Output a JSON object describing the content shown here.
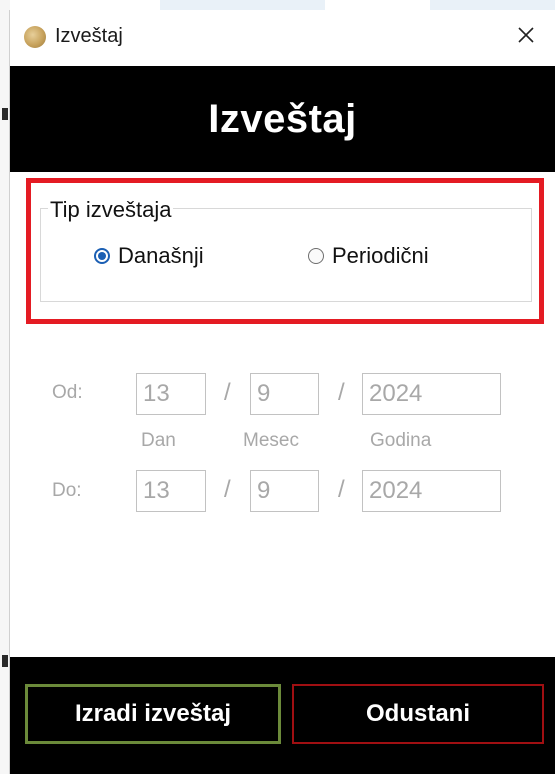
{
  "window": {
    "title": "Izveštaj",
    "close_glyph": "✕",
    "app_icon": "coin-icon"
  },
  "header": {
    "title": "Izveštaj"
  },
  "report_type": {
    "legend": "Tip izveštaja",
    "options": [
      {
        "label": "Današnji",
        "selected": true
      },
      {
        "label": "Periodični",
        "selected": false
      }
    ]
  },
  "date_range": {
    "from_label": "Od:",
    "to_label": "Do:",
    "separator": "/",
    "field_labels": {
      "day": "Dan",
      "month": "Mesec",
      "year": "Godina"
    },
    "from": {
      "day": "13",
      "month": "9",
      "year": "2024"
    },
    "to": {
      "day": "13",
      "month": "9",
      "year": "2024"
    },
    "disabled": true
  },
  "actions": {
    "create_label": "Izradi izveštaj",
    "cancel_label": "Odustani"
  },
  "colors": {
    "highlight": "#e41b23",
    "radio_accent": "#1b5fb4",
    "create_border": "#6b8a3a",
    "cancel_border": "#a00f12",
    "band": "#000000"
  }
}
